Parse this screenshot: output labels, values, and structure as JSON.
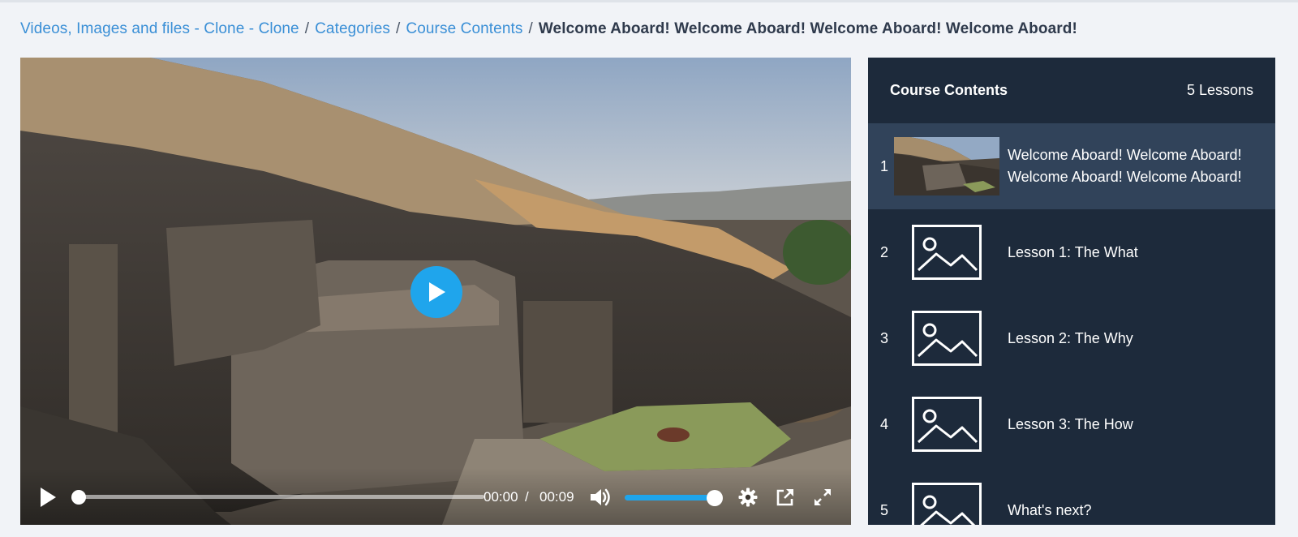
{
  "breadcrumb": {
    "items": [
      "Videos, Images and files - Clone - Clone",
      "Categories",
      "Course Contents"
    ],
    "separator": "/",
    "current": "Welcome Aboard! Welcome Aboard! Welcome Aboard! Welcome Aboard!"
  },
  "player": {
    "current_time": "00:00",
    "time_separator": "/",
    "duration": "00:09",
    "progress": 0.0,
    "volume": 1.0,
    "accent_color": "#1fa5ec",
    "icons": [
      "play-icon",
      "volume-icon",
      "settings-icon",
      "popout-icon",
      "fullscreen-icon"
    ]
  },
  "course_contents": {
    "title": "Course Contents",
    "lesson_count": "5 Lessons",
    "lessons": [
      {
        "number": "1",
        "title": "Welcome Aboard! Welcome Aboard! Welcome Aboard! Welcome Aboard!",
        "active": true,
        "thumbnail": "video-thumbnail"
      },
      {
        "number": "2",
        "title": "Lesson 1: The What",
        "active": false,
        "thumbnail": "image-placeholder-icon"
      },
      {
        "number": "3",
        "title": "Lesson 2: The Why",
        "active": false,
        "thumbnail": "image-placeholder-icon"
      },
      {
        "number": "4",
        "title": "Lesson 3: The How",
        "active": false,
        "thumbnail": "image-placeholder-icon"
      },
      {
        "number": "5",
        "title": "What's next?",
        "active": false,
        "thumbnail": "image-placeholder-icon"
      }
    ]
  },
  "colors": {
    "link": "#3a8fd6",
    "panel_background": "#1d2a3b",
    "active_lesson_background": "#31435a",
    "page_background": "#f1f3f7"
  }
}
